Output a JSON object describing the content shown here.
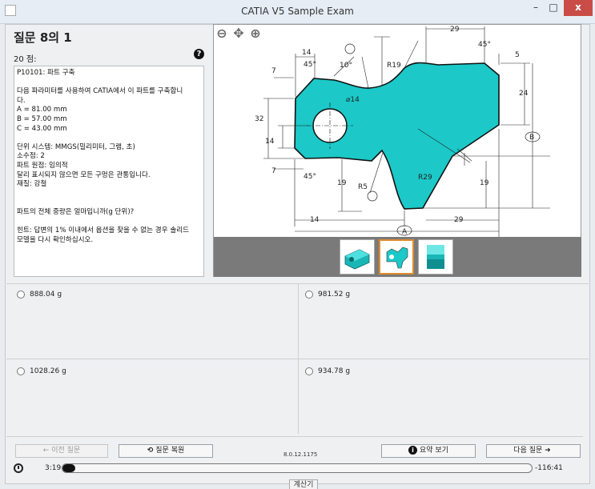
{
  "window": {
    "title": "CATIA V5 Sample Exam",
    "minimize_icon": "minimize-icon",
    "maximize_icon": "maximize-icon",
    "close_icon": "close-icon",
    "min_glyph": "–",
    "max_glyph": "□",
    "close_glyph": "x"
  },
  "question": {
    "title": "질문 8의 1",
    "points": "20 점:",
    "help_glyph": "?",
    "lines": [
      "P10101: 파트 구축",
      "",
      "다음 파라미터를 사용하여 CATIA에서 이 파트를 구축합니",
      "다.",
      "A = 81.00 mm",
      "B = 57.00 mm",
      "C = 43.00 mm",
      "",
      "단위 시스템: MMGS(밀리미터, 그램, 초)",
      "소수점: 2",
      "파트 원점: 임의적",
      "달리 표시되지 않으면 모든 구멍은 관통입니다.",
      "재질: 강철",
      "",
      "",
      "파트의 전체 중량은 얼마입니까(g 단위)?",
      "",
      "힌트: 답변의 1% 이내에서 옵션을 찾을 수 없는 경우 솔리드",
      "모델을 다시 확인하십시오."
    ]
  },
  "drawing": {
    "dims": [
      "29",
      "45°",
      "5",
      "14",
      "7",
      "45°",
      "10°",
      "R19",
      "24",
      "32",
      "⌀14",
      "14",
      "B",
      "7",
      "45°",
      "R5",
      "R29",
      "19",
      "19",
      "14",
      "29",
      "A"
    ],
    "accent": "#1cc8c8",
    "zoom_out_icon": "zoom-out-icon",
    "fit_icon": "fit-icon",
    "zoom_in_icon": "zoom-in-icon"
  },
  "answers": [
    {
      "label": "888.04 g"
    },
    {
      "label": "981.52 g"
    },
    {
      "label": "1028.26 g"
    },
    {
      "label": "934.78 g"
    }
  ],
  "footer": {
    "prev": "← 이전 질문",
    "reset": "질문 복원",
    "reset_glyph": "⟲",
    "version": "8.0.12.1175",
    "summary": "요약 보기",
    "summary_glyph": "i",
    "next": "다음 질문",
    "next_glyph": "➜",
    "time_elapsed": "3:19",
    "time_remaining": "-116:41",
    "progress": 0.027,
    "calculator": "계산기"
  }
}
